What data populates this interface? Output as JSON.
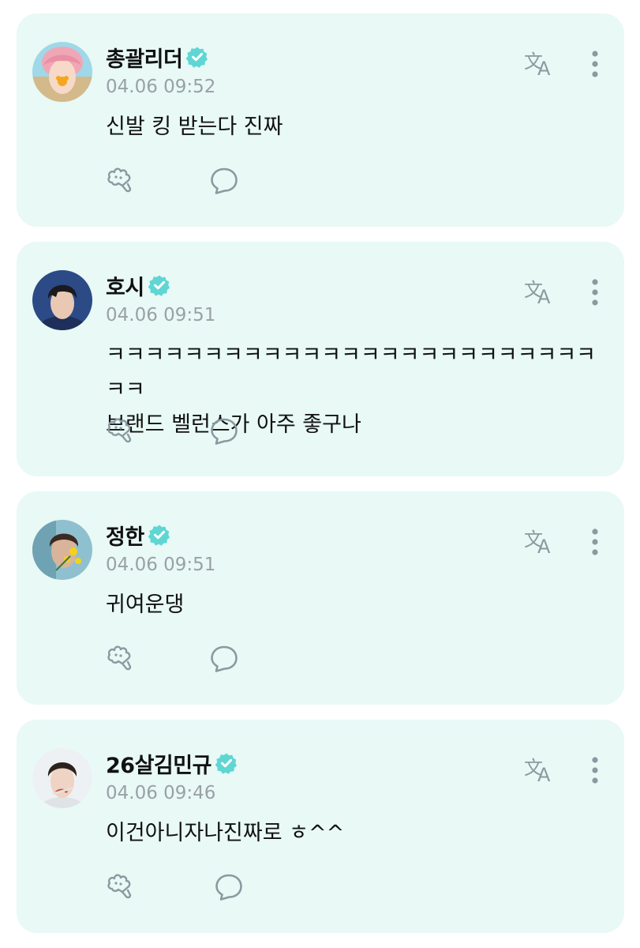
{
  "colors": {
    "card_background": "#e8f9f6",
    "accent": "#5fd6d3",
    "icon": "#8a9aa0",
    "timestamp": "#9aa1a6"
  },
  "posts": [
    {
      "author": "총괄리더",
      "verified": true,
      "timestamp": "04.06 09:52",
      "text": "신발 킹 받는다 진짜",
      "avatar": "avatar-pink-hair",
      "icons": {
        "translate": "translate-icon",
        "more": "more-vertical-icon",
        "like": "like-icon",
        "comment": "comment-icon"
      }
    },
    {
      "author": "호시",
      "verified": true,
      "timestamp": "04.06 09:51",
      "text": "ㅋㅋㅋㅋㅋㅋㅋㅋㅋㅋㅋㅋㅋㅋㅋㅋㅋㅋㅋㅋㅋㅋㅋㅋㅋㅋㅋ\n브랜드 벨런스가 아주 좋구나",
      "avatar": "avatar-dark-hair-blue",
      "icons": {
        "translate": "translate-icon",
        "more": "more-vertical-icon",
        "like": "like-icon",
        "comment": "comment-icon"
      }
    },
    {
      "author": "정한",
      "verified": true,
      "timestamp": "04.06 09:51",
      "text": "귀여운댕",
      "avatar": "avatar-flowers",
      "icons": {
        "translate": "translate-icon",
        "more": "more-vertical-icon",
        "like": "like-icon",
        "comment": "comment-icon"
      }
    },
    {
      "author": "26살김민규",
      "verified": true,
      "timestamp": "04.06 09:46",
      "text": "이건아니자나진짜로 ㅎ^^",
      "avatar": "avatar-light-background",
      "icons": {
        "translate": "translate-icon",
        "more": "more-vertical-icon",
        "like": "like-icon",
        "comment": "comment-icon"
      }
    }
  ]
}
